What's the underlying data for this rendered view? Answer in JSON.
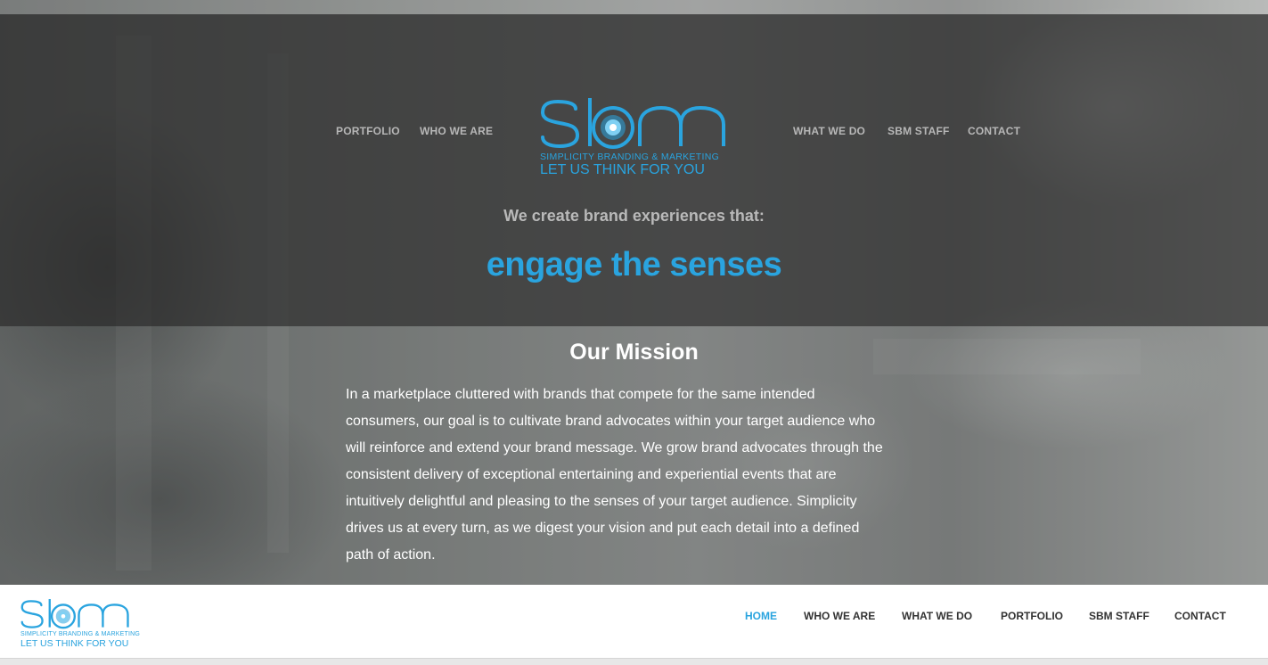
{
  "colors": {
    "accent": "#2aa4df",
    "hero_overlay": "#282828",
    "nav_grey": "#b7b7b7",
    "footer_text": "#333333"
  },
  "hero_nav": {
    "left": [
      "PORTFOLIO",
      "WHO WE ARE"
    ],
    "right": [
      "WHAT WE DO",
      "SBM STAFF",
      "CONTACT"
    ]
  },
  "logo": {
    "letters": "sbm",
    "sub_line": "SIMPLICITY BRANDING & MARKETING",
    "slogan": "LET US THINK FOR YOU"
  },
  "hero": {
    "intro": "We create brand experiences that:",
    "headline": "engage the senses"
  },
  "mission": {
    "title": "Our Mission",
    "lines": [
      "In a marketplace cluttered with brands that compete for the same intended",
      "consumers, our goal is to cultivate brand advocates within your target audience who",
      "will reinforce and extend your brand message. We grow brand advocates through the",
      "consistent delivery of exceptional entertaining and experiential events that are",
      "intuitively delightful and pleasing to the senses of your target audience. Simplicity",
      "drives us at every turn, as we digest your vision and put each detail into a defined",
      "path of action."
    ]
  },
  "footer_nav": {
    "items": [
      "HOME",
      "WHO WE ARE",
      "WHAT WE DO",
      "PORTFOLIO",
      "SBM STAFF",
      "CONTACT"
    ],
    "active": "HOME"
  }
}
